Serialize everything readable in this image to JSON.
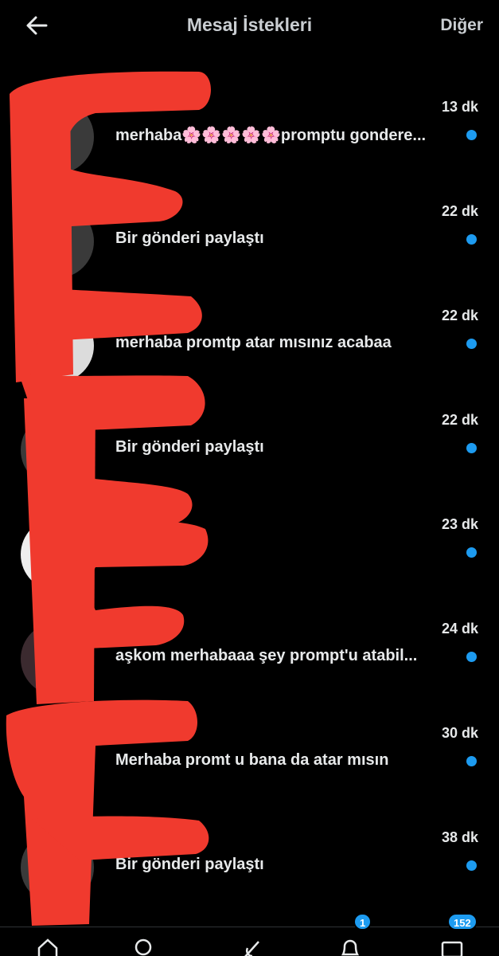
{
  "header": {
    "title": "Mesaj İstekleri",
    "more_label": "Diğer"
  },
  "requests": [
    {
      "time": "13 dk",
      "message": "merhaba🌸🌸🌸🌸🌸promptu gondere..."
    },
    {
      "time": "22 dk",
      "message": "Bir gönderi paylaştı"
    },
    {
      "time": "22 dk",
      "message": "merhaba promtp atar mısınız acabaa"
    },
    {
      "time": "22 dk",
      "message": "Bir gönderi paylaştı"
    },
    {
      "time": "23 dk",
      "message": ""
    },
    {
      "time": "24 dk",
      "message": "aşkom merhabaaa şey prompt'u atabil..."
    },
    {
      "time": "30 dk",
      "message": "Merhaba promt u bana da atar mısın"
    },
    {
      "time": "38 dk",
      "message": "Bir gönderi paylaştı"
    }
  ],
  "bottom_nav": {
    "notifications_badge": "1",
    "messages_badge": "152"
  },
  "colors": {
    "background": "#000000",
    "unread_dot": "#1d9bf0",
    "redaction": "#f03a2e"
  }
}
